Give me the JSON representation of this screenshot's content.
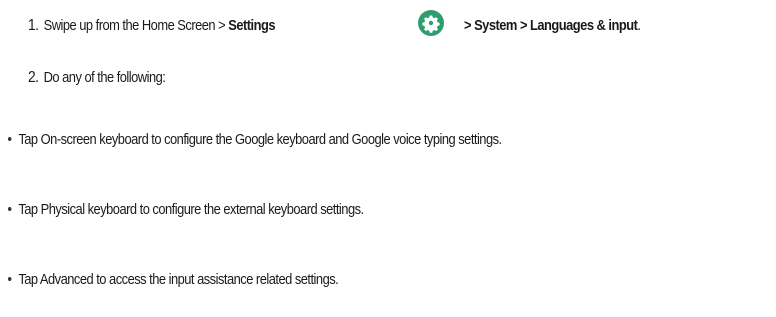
{
  "steps": [
    {
      "number": "1.",
      "parts": {
        "pre": "Swipe up from the Home Screen > ",
        "settings": "Settings",
        "path": "> System > Languages & input",
        "period": "."
      },
      "icon": "settings-gear-icon"
    },
    {
      "number": "2.",
      "text": "Do any of the following:"
    }
  ],
  "bullets": [
    "Tap On-screen keyboard to configure the Google keyboard and Google voice typing settings.",
    "Tap Physical keyboard to configure the external keyboard settings.",
    "Tap Advanced to access the input assistance related settings."
  ],
  "colors": {
    "settings_icon_bg": "#2e9e6e",
    "text": "#1a1a1a"
  }
}
